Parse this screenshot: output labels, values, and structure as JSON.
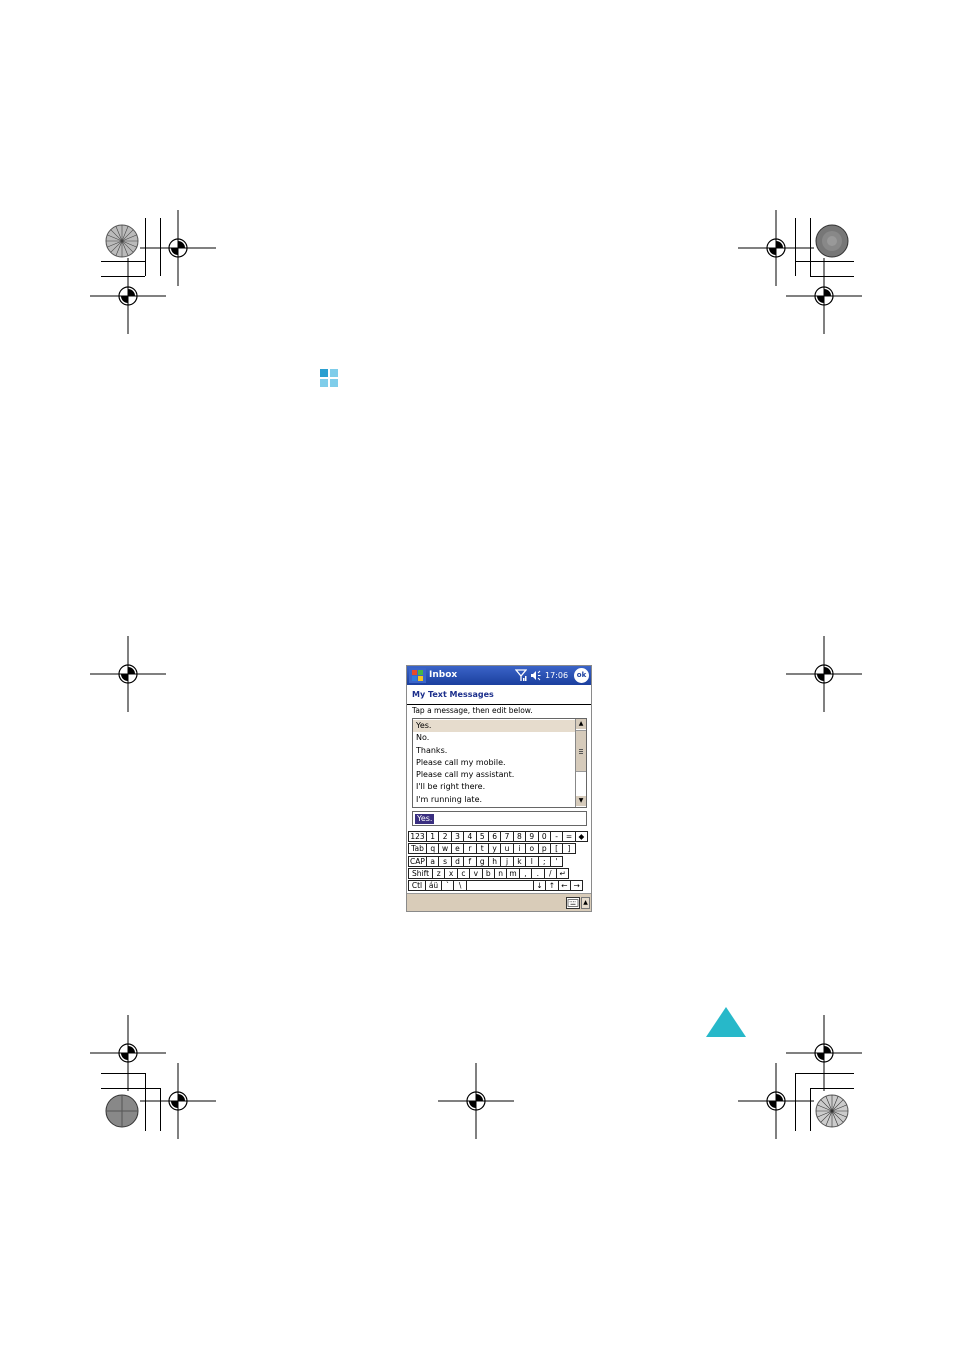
{
  "device": {
    "titlebar": {
      "app_title": "Inbox",
      "clock": "17:06",
      "ok_label": "ok"
    },
    "header_title": "My Text Messages",
    "instruction": "Tap a message, then edit below.",
    "messages": [
      "Yes.",
      "No.",
      "Thanks.",
      "Please call my mobile.",
      "Please call my assistant.",
      "I'll be right there.",
      "I'm running late."
    ],
    "selected_message_index": 0,
    "edit_value": "Yes.",
    "keyboard": {
      "rows": [
        [
          "123",
          "1",
          "2",
          "3",
          "4",
          "5",
          "6",
          "7",
          "8",
          "9",
          "0",
          "-",
          "=",
          "◆"
        ],
        [
          "Tab",
          "q",
          "w",
          "e",
          "r",
          "t",
          "y",
          "u",
          "i",
          "o",
          "p",
          "[",
          "]"
        ],
        [
          "CAP",
          "a",
          "s",
          "d",
          "f",
          "g",
          "h",
          "j",
          "k",
          "l",
          ";",
          "'"
        ],
        [
          "Shift",
          "z",
          "x",
          "c",
          "v",
          "b",
          "n",
          "m",
          ",",
          ".",
          "/",
          "↵"
        ],
        [
          "Ctl",
          "áü",
          "`",
          "\\",
          " ",
          "↓",
          "↑",
          "←",
          "→"
        ]
      ]
    }
  },
  "colors": {
    "titlebar": "#1b3f9e",
    "header_text": "#1c2f8c",
    "selection": "#e6dccd",
    "edit_highlight": "#3a2f80",
    "triangle": "#27b8c9",
    "section_icon": "#2a9fd0"
  },
  "icons": [
    "start-menu-icon",
    "signal-icon",
    "speaker-icon",
    "ok-icon",
    "scroll-up-icon",
    "scroll-down-icon",
    "keyboard-icon",
    "chevron-up-icon",
    "section-icon",
    "triangle-icon",
    "registration-mark-icon",
    "rosette-icon"
  ]
}
